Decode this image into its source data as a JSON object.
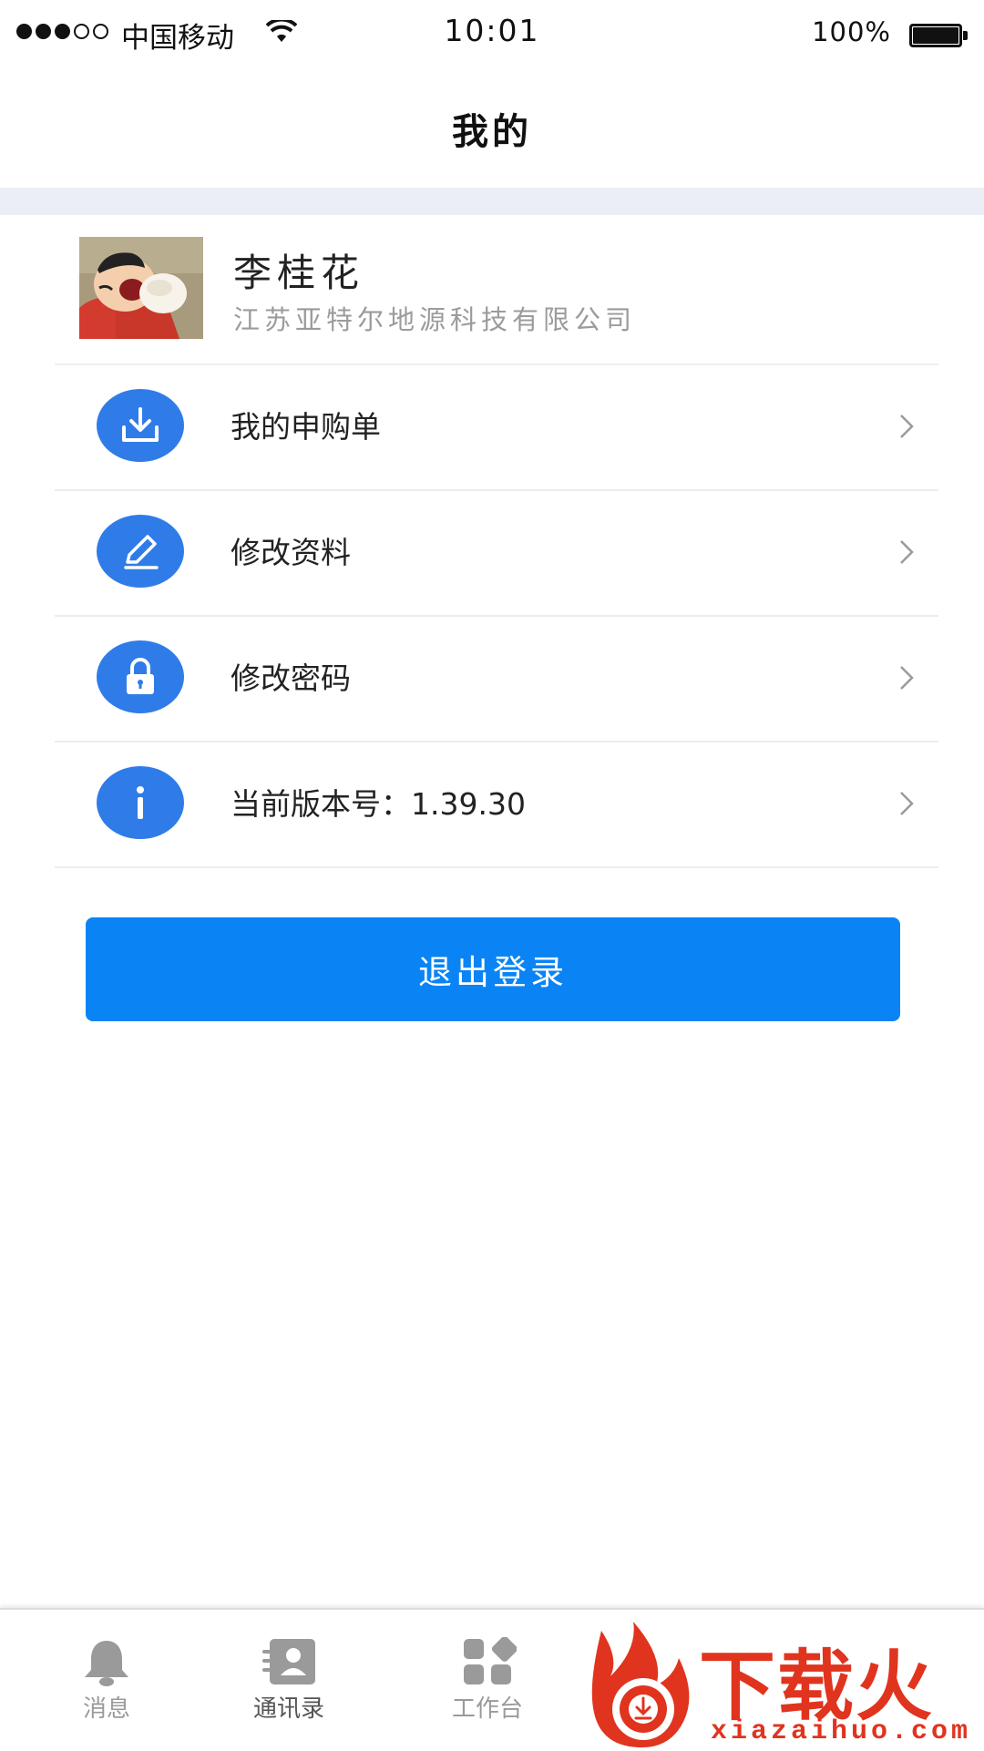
{
  "status_bar": {
    "carrier": "中国移动",
    "time": "10:01",
    "battery_percent": "100%",
    "signal_strength": 3,
    "signal_max": 5
  },
  "header": {
    "title": "我的"
  },
  "profile": {
    "name": "李桂花",
    "company": "江苏亚特尔地源科技有限公司"
  },
  "menu": [
    {
      "label": "我的申购单",
      "icon": "download-icon"
    },
    {
      "label": "修改资料",
      "icon": "edit-icon"
    },
    {
      "label": "修改密码",
      "icon": "lock-icon"
    },
    {
      "label": "当前版本号：1.39.30",
      "icon": "info-icon"
    }
  ],
  "logout": {
    "label": "退出登录"
  },
  "tabs": [
    {
      "label": "消息",
      "icon": "bell-icon"
    },
    {
      "label": "通讯录",
      "icon": "contacts-icon"
    },
    {
      "label": "工作台",
      "icon": "workbench-icon"
    }
  ],
  "watermark": {
    "text": "下载火",
    "domain": "xiazaihuo.com"
  },
  "colors": {
    "primary": "#0a84f5",
    "icon_bg": "#2f7ce8",
    "divider": "#ebeef4",
    "watermark": "#e0341e"
  }
}
